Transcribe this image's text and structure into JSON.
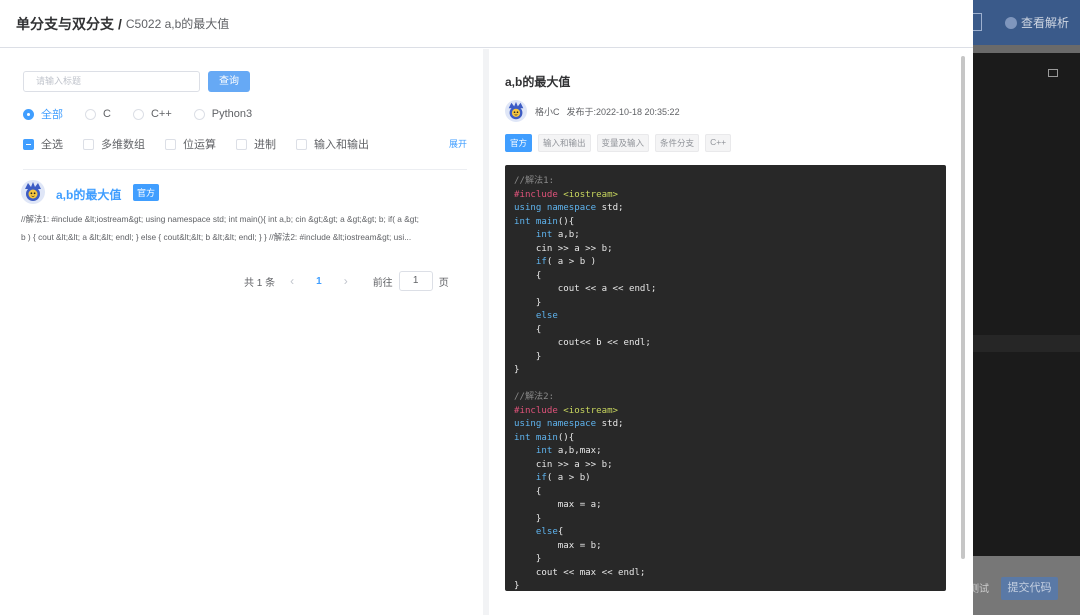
{
  "header": {
    "title": "单分支与双分支",
    "separator": "/",
    "subtitle": "C5022 a,b的最大值"
  },
  "search": {
    "placeholder": "请输入标题",
    "button": "查询"
  },
  "languages": [
    {
      "label": "全部",
      "selected": true
    },
    {
      "label": "C",
      "selected": false
    },
    {
      "label": "C++",
      "selected": false
    },
    {
      "label": "Python3",
      "selected": false
    }
  ],
  "filters": [
    {
      "label": "全选",
      "checked": true
    },
    {
      "label": "多维数组",
      "checked": false
    },
    {
      "label": "位运算",
      "checked": false
    },
    {
      "label": "进制",
      "checked": false
    },
    {
      "label": "输入和输出",
      "checked": false
    }
  ],
  "expand_label": "展开",
  "result": {
    "title": "a,b的最大值",
    "badge": "官方",
    "desc_line1": "//解法1: #include &lt;iostream&gt; using namespace std; int main(){ int a,b; cin &gt;&gt; a &gt;&gt; b; if( a &gt;",
    "desc_line2": "b ) { cout &lt;&lt; a &lt;&lt; endl; } else { cout&lt;&lt; b &lt;&lt; endl; } } //解法2:   #include &lt;iostream&gt; usi..."
  },
  "pagination": {
    "total": "共 1 条",
    "prev": "‹",
    "current": "1",
    "next": "›",
    "goto": "前往",
    "page_value": "1",
    "page_unit": "页"
  },
  "detail": {
    "title": "a,b的最大值",
    "author": "格小C",
    "published": "发布于:2022-10-18 20:35:22",
    "tags": [
      "官方",
      "输入和输出",
      "变量及输入",
      "条件分支",
      "C++"
    ]
  },
  "code_lines": [
    "//解法1:",
    "#include <iostream>",
    "using namespace std;",
    "int main(){",
    "    int a,b;",
    "    cin >> a >> b;",
    "    if( a > b )",
    "    {",
    "        cout << a << endl;",
    "    }",
    "    else",
    "    {",
    "        cout<< b << endl;",
    "    }",
    "}",
    "",
    "//解法2:",
    "#include <iostream>",
    "using namespace std;",
    "int main(){",
    "    int a,b,max;",
    "    cin >> a >> b;",
    "    if( a > b)",
    "    {",
    "        max = a;",
    "    }",
    "    else{",
    "        max = b;",
    "    }",
    "    cout << max << endl;",
    "}"
  ],
  "background_app": {
    "view_analysis": "查看解析",
    "run": "测试",
    "submit": "提交代码"
  },
  "colors": {
    "accent": "#409eff",
    "code_bg": "#282828",
    "keyword": "#5fb4ef",
    "preprocessor": "#e0527a",
    "string": "#c8d65e",
    "comment": "#8a8a8a"
  },
  "icons": {
    "avatar": "avatar-icon",
    "monitor": "monitor-icon"
  }
}
